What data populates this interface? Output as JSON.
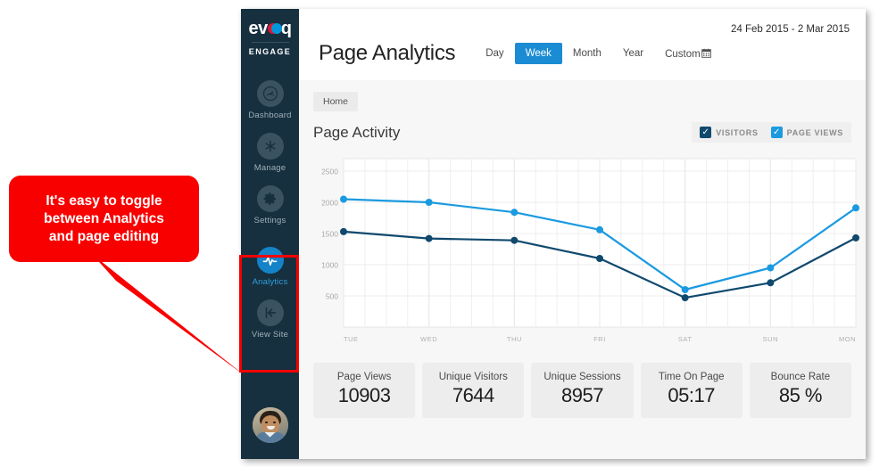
{
  "annotation": {
    "callout_text": "It's easy to toggle\nbetween Analytics\nand page editing",
    "callout_color": "#f90000",
    "highlight_color": "#f40000"
  },
  "sidebar": {
    "brand": {
      "name_prefix": "ev",
      "name_suffix": "q",
      "subtitle": "ENGAGE"
    },
    "items": [
      {
        "label": "Dashboard",
        "icon": "gauge-icon",
        "active": false
      },
      {
        "label": "Manage",
        "icon": "asterisk-icon",
        "active": false
      },
      {
        "label": "Settings",
        "icon": "gear-icon",
        "active": false
      },
      {
        "label": "Analytics",
        "icon": "pulse-icon",
        "active": true
      },
      {
        "label": "View Site",
        "icon": "back-arrow-icon",
        "active": false
      }
    ],
    "avatar": "user-avatar",
    "active_color": "#2f9fe0",
    "background": "#16303f"
  },
  "header": {
    "title": "Page Analytics",
    "date_range": "24 Feb 2015 - 2 Mar 2015",
    "range_tabs": [
      {
        "label": "Day",
        "active": false
      },
      {
        "label": "Week",
        "active": true
      },
      {
        "label": "Month",
        "active": false
      },
      {
        "label": "Year",
        "active": false
      },
      {
        "label": "Custom",
        "active": false,
        "icon": "calendar-icon"
      }
    ],
    "active_tab_color": "#1b8cd4"
  },
  "breadcrumb": {
    "label": "Home"
  },
  "panel": {
    "title": "Page Activity",
    "legend": [
      {
        "label": "VISITORS",
        "color": "#10496e",
        "checked": true
      },
      {
        "label": "PAGE VIEWS",
        "color": "#1b9ae0",
        "checked": true
      }
    ]
  },
  "chart_data": {
    "type": "line",
    "title": "Page Activity",
    "xlabel": "",
    "ylabel": "",
    "categories": [
      "TUE",
      "WED",
      "THU",
      "FRI",
      "SAT",
      "SUN",
      "MON"
    ],
    "ylim": [
      0,
      2700
    ],
    "yticks": [
      500,
      1000,
      1500,
      2000,
      2500
    ],
    "grid": true,
    "legend_position": "top-right",
    "series": [
      {
        "name": "PAGE VIEWS",
        "color": "#1b9ae0",
        "values": [
          2050,
          2000,
          1840,
          1560,
          600,
          950,
          1910
        ]
      },
      {
        "name": "VISITORS",
        "color": "#10496e",
        "values": [
          1530,
          1420,
          1390,
          1100,
          470,
          710,
          1430
        ]
      }
    ]
  },
  "stats": [
    {
      "label": "Page Views",
      "value": "10903"
    },
    {
      "label": "Unique Visitors",
      "value": "7644"
    },
    {
      "label": "Unique Sessions",
      "value": "8957"
    },
    {
      "label": "Time On Page",
      "value": "05:17"
    },
    {
      "label": "Bounce Rate",
      "value": "85 %"
    }
  ]
}
